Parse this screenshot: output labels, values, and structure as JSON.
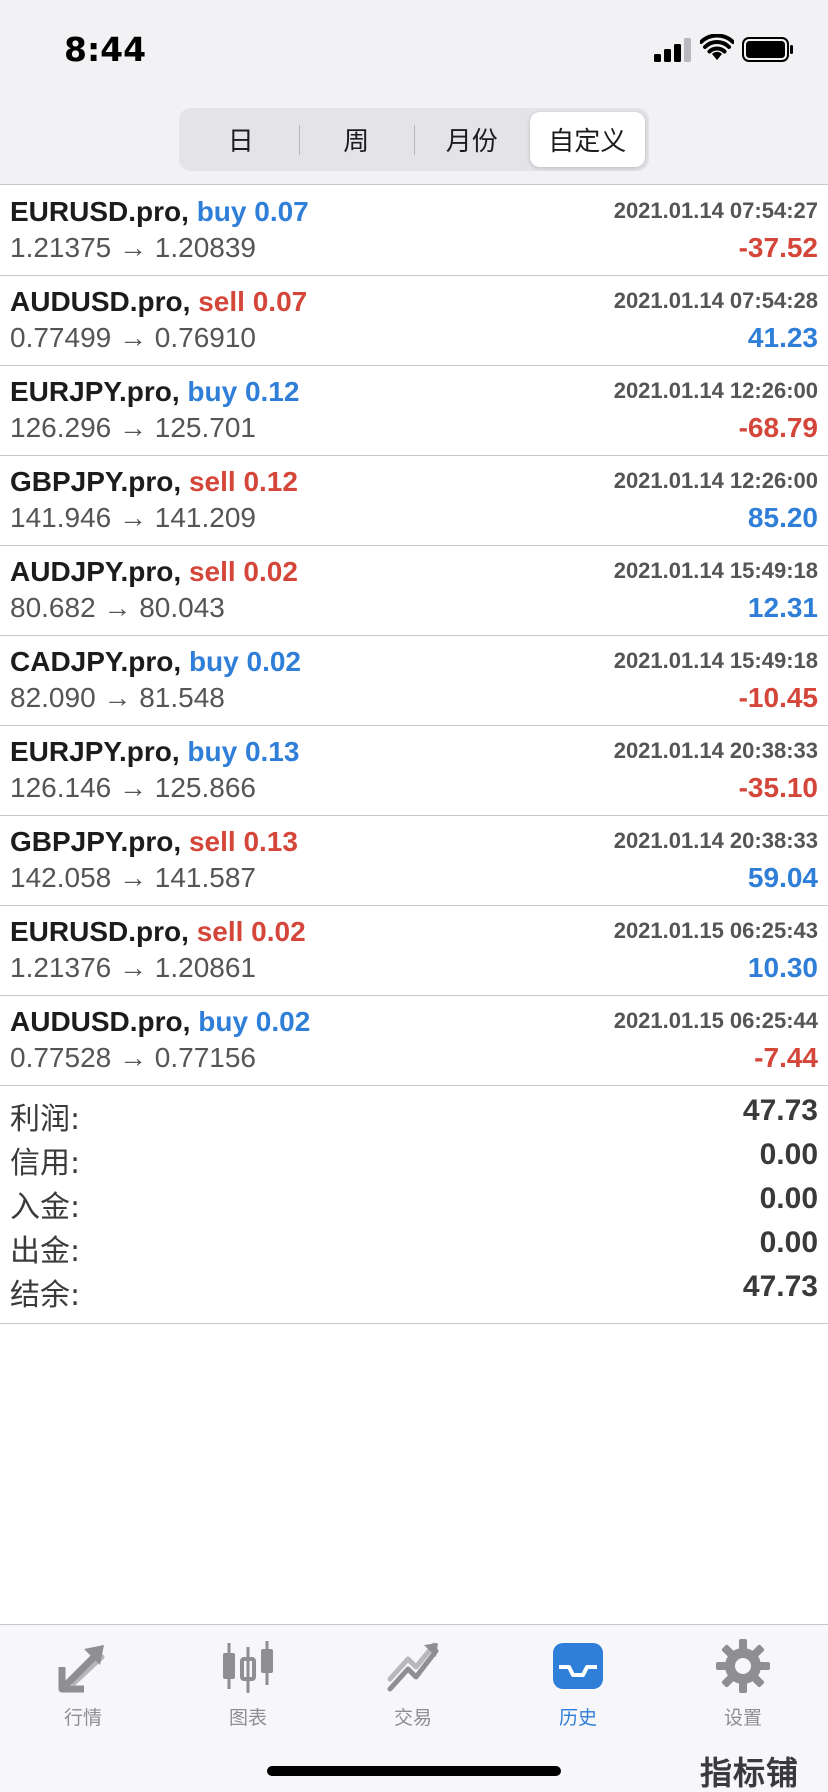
{
  "status_bar": {
    "time": "8:44",
    "signal_icon": "signal-bars-icon",
    "wifi_icon": "wifi-icon",
    "battery_icon": "battery-icon"
  },
  "period_tabs": [
    {
      "label": "日",
      "active": false
    },
    {
      "label": "周",
      "active": false
    },
    {
      "label": "月份",
      "active": false
    },
    {
      "label": "自定义",
      "active": true
    }
  ],
  "trades": [
    {
      "symbol": "EURUSD.pro,",
      "side": "buy",
      "volume": "0.07",
      "time": "2021.01.14 07:54:27",
      "open_price": "1.21375",
      "arrow": "→",
      "close_price": "1.20839",
      "profit": "-37.52"
    },
    {
      "symbol": "AUDUSD.pro,",
      "side": "sell",
      "volume": "0.07",
      "time": "2021.01.14 07:54:28",
      "open_price": "0.77499",
      "arrow": "→",
      "close_price": "0.76910",
      "profit": "41.23"
    },
    {
      "symbol": "EURJPY.pro,",
      "side": "buy",
      "volume": "0.12",
      "time": "2021.01.14 12:26:00",
      "open_price": "126.296",
      "arrow": "→",
      "close_price": "125.701",
      "profit": "-68.79"
    },
    {
      "symbol": "GBPJPY.pro,",
      "side": "sell",
      "volume": "0.12",
      "time": "2021.01.14 12:26:00",
      "open_price": "141.946",
      "arrow": "→",
      "close_price": "141.209",
      "profit": "85.20"
    },
    {
      "symbol": "AUDJPY.pro,",
      "side": "sell",
      "volume": "0.02",
      "time": "2021.01.14 15:49:18",
      "open_price": "80.682",
      "arrow": "→",
      "close_price": "80.043",
      "profit": "12.31"
    },
    {
      "symbol": "CADJPY.pro,",
      "side": "buy",
      "volume": "0.02",
      "time": "2021.01.14 15:49:18",
      "open_price": "82.090",
      "arrow": "→",
      "close_price": "81.548",
      "profit": "-10.45"
    },
    {
      "symbol": "EURJPY.pro,",
      "side": "buy",
      "volume": "0.13",
      "time": "2021.01.14 20:38:33",
      "open_price": "126.146",
      "arrow": "→",
      "close_price": "125.866",
      "profit": "-35.10"
    },
    {
      "symbol": "GBPJPY.pro,",
      "side": "sell",
      "volume": "0.13",
      "time": "2021.01.14 20:38:33",
      "open_price": "142.058",
      "arrow": "→",
      "close_price": "141.587",
      "profit": "59.04"
    },
    {
      "symbol": "EURUSD.pro,",
      "side": "sell",
      "volume": "0.02",
      "time": "2021.01.15 06:25:43",
      "open_price": "1.21376",
      "arrow": "→",
      "close_price": "1.20861",
      "profit": "10.30"
    },
    {
      "symbol": "AUDUSD.pro,",
      "side": "buy",
      "volume": "0.02",
      "time": "2021.01.15 06:25:44",
      "open_price": "0.77528",
      "arrow": "→",
      "close_price": "0.77156",
      "profit": "-7.44"
    }
  ],
  "summary": [
    {
      "label": "利润:",
      "value": "47.73"
    },
    {
      "label": "信用:",
      "value": "0.00"
    },
    {
      "label": "入金:",
      "value": "0.00"
    },
    {
      "label": "出金:",
      "value": "0.00"
    },
    {
      "label": "结余:",
      "value": "47.73"
    }
  ],
  "tabbar": [
    {
      "label": "行情",
      "icon": "quotes-arrows-icon",
      "active": false
    },
    {
      "label": "图表",
      "icon": "candlestick-chart-icon",
      "active": false
    },
    {
      "label": "交易",
      "icon": "trade-trend-icon",
      "active": false
    },
    {
      "label": "历史",
      "icon": "history-inbox-icon",
      "active": true
    },
    {
      "label": "设置",
      "icon": "gear-icon",
      "active": false
    }
  ],
  "watermark": "指标铺",
  "colors": {
    "buy": "#2f7fd8",
    "sell": "#d4463a",
    "active_tab": "#2f7fd8",
    "inactive_tab": "#8e8e93"
  }
}
